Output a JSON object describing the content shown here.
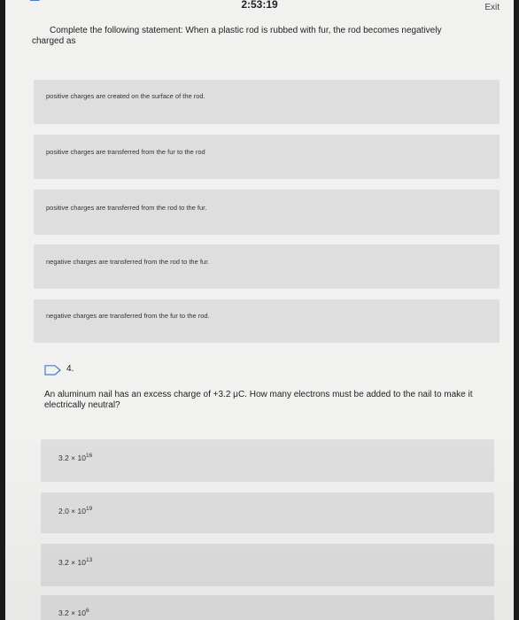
{
  "header": {
    "timer": "2:53:19",
    "exit_label": "Exit"
  },
  "question3": {
    "text": "Complete the following statement: When a plastic rod is rubbed with fur, the rod becomes negatively charged as",
    "options": [
      "positive charges are created on the surface of the rod.",
      "positive charges are transferred from the fur to the rod",
      "positive charges are transferred from the rod to the fur.",
      "negative charges are transferred from the rod to the fur.",
      "negative charges are transferred from the fur to the rod."
    ]
  },
  "question4": {
    "number": "4.",
    "text": "An aluminum nail has an excess charge of +3.2 μC. How many electrons must be added to the nail to make it electrically neutral?",
    "options": [
      {
        "base": "3.2 × 10",
        "exp": "16"
      },
      {
        "base": "2.0 × 10",
        "exp": "19"
      },
      {
        "base": "3.2 × 10",
        "exp": "13"
      },
      {
        "base": "3.2 × 10",
        "exp": "6"
      }
    ]
  },
  "icons": {
    "flag": "flag-icon"
  }
}
